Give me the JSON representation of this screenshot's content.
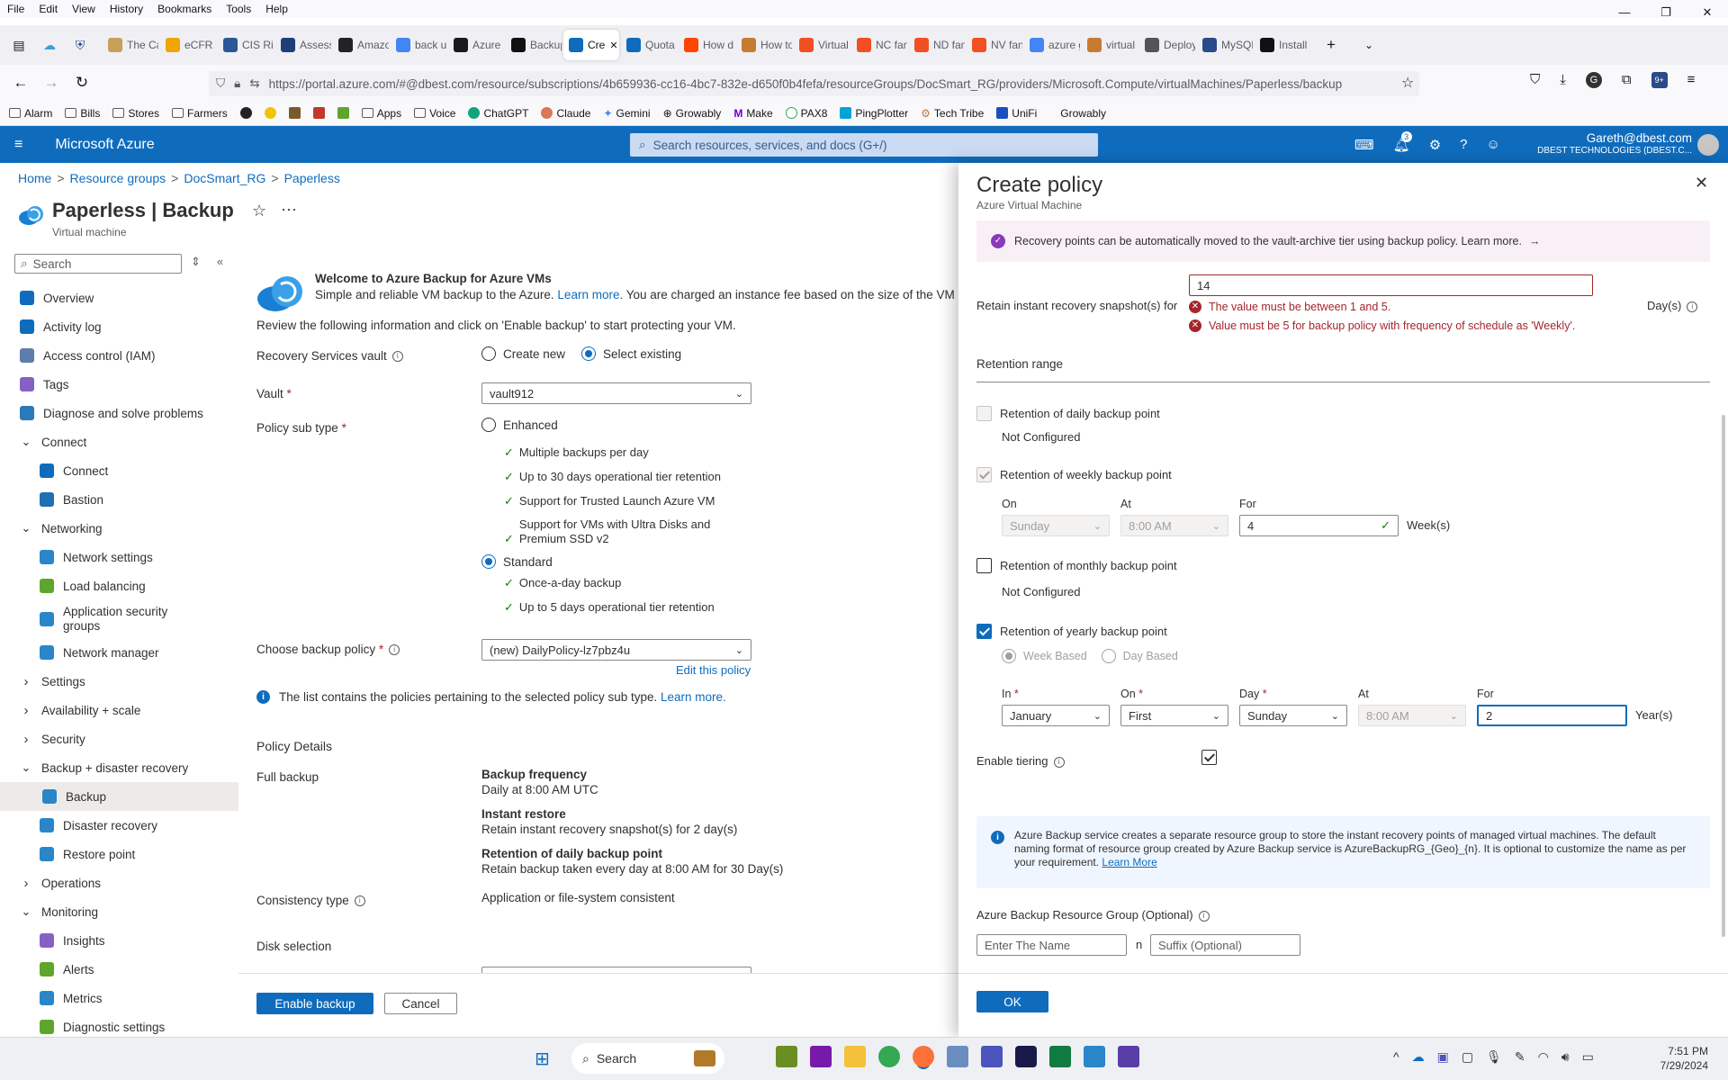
{
  "browser": {
    "menu": [
      "File",
      "Edit",
      "View",
      "History",
      "Bookmarks",
      "Tools",
      "Help"
    ],
    "tabs": [
      {
        "label": "The Ca",
        "color": "#c7a15b"
      },
      {
        "label": "eCFR ::",
        "color": "#f0a500"
      },
      {
        "label": "CIS Risl",
        "color": "#2b5797"
      },
      {
        "label": "Assess:",
        "color": "#1f3f7a"
      },
      {
        "label": "Amazo",
        "color": "#222222"
      },
      {
        "label": "back u",
        "color": "#4285f4"
      },
      {
        "label": "Azure I",
        "color": "#1a1a1a"
      },
      {
        "label": "Backup",
        "color": "#111111"
      },
      {
        "label": "Cre",
        "color": "#0f6cbd",
        "active": true
      },
      {
        "label": "Quota",
        "color": "#0f6cbd"
      },
      {
        "label": "How d",
        "color": "#ff4500"
      },
      {
        "label": "How to",
        "color": "#c77b30"
      },
      {
        "label": "Virtual",
        "color": "#f25022"
      },
      {
        "label": "NC fan",
        "color": "#f25022"
      },
      {
        "label": "ND fan",
        "color": "#f25022"
      },
      {
        "label": "NV fan",
        "color": "#f25022"
      },
      {
        "label": "azure g",
        "color": "#4285f4"
      },
      {
        "label": "virtual",
        "color": "#c77b30"
      },
      {
        "label": "Deploy",
        "color": "#555555"
      },
      {
        "label": "MySQL",
        "color": "#2b4a8a"
      },
      {
        "label": "Install I",
        "color": "#111111"
      }
    ],
    "url": "https://portal.azure.com/#@dbest.com/resource/subscriptions/4b659936-cc16-4bc7-832e-d650f0b4fefa/resourceGroups/DocSmart_RG/providers/Microsoft.Compute/virtualMachines/Paperless/backup",
    "extension_badge": "9+",
    "bookmarks": [
      "Alarm",
      "Bills",
      "Stores",
      "Farmers",
      "Apps",
      "Voice",
      "ChatGPT",
      "Claude",
      "Gemini",
      "Growably",
      "Make",
      "PAX8",
      "PingPlotter",
      "Tech Tribe",
      "UniFi",
      "Growably"
    ]
  },
  "azure": {
    "brand": "Microsoft Azure",
    "search_placeholder": "Search resources, services, and docs (G+/)",
    "notification_count": "3",
    "user_name": "Gareth@dbest.com",
    "user_org": "DBEST TECHNOLOGIES (DBEST.C..."
  },
  "breadcrumb": [
    "Home",
    "Resource groups",
    "DocSmart_RG",
    "Paperless"
  ],
  "page": {
    "title": "Paperless | Backup",
    "subtitle": "Virtual machine"
  },
  "leftnav": {
    "search_placeholder": "Search",
    "items": [
      {
        "label": "Overview",
        "level": 0,
        "icon": "#0f6cbd"
      },
      {
        "label": "Activity log",
        "level": 0,
        "icon": "#0f6cbd"
      },
      {
        "label": "Access control (IAM)",
        "level": 0,
        "icon": "#5c7ea8"
      },
      {
        "label": "Tags",
        "level": 0,
        "icon": "#8661c5"
      },
      {
        "label": "Diagnose and solve problems",
        "level": 0,
        "icon": "#2a7ab9"
      },
      {
        "label": "Connect",
        "level": 0,
        "group": true,
        "expanded": true
      },
      {
        "label": "Connect",
        "level": 1,
        "icon": "#0f6cbd"
      },
      {
        "label": "Bastion",
        "level": 1,
        "icon": "#1f6fb3"
      },
      {
        "label": "Networking",
        "level": 0,
        "group": true,
        "expanded": true
      },
      {
        "label": "Network settings",
        "level": 1,
        "icon": "#2a86c8"
      },
      {
        "label": "Load balancing",
        "level": 1,
        "icon": "#5ea52e"
      },
      {
        "label": "Application security groups",
        "level": 1,
        "icon": "#2a86c8",
        "two": true
      },
      {
        "label": "Network manager",
        "level": 1,
        "icon": "#2a86c8"
      },
      {
        "label": "Settings",
        "level": 0,
        "group": true,
        "expanded": false
      },
      {
        "label": "Availability + scale",
        "level": 0,
        "group": true,
        "expanded": false
      },
      {
        "label": "Security",
        "level": 0,
        "group": true,
        "expanded": false
      },
      {
        "label": "Backup + disaster recovery",
        "level": 0,
        "group": true,
        "expanded": true
      },
      {
        "label": "Backup",
        "level": 1,
        "icon": "#2a86c8",
        "selected": true
      },
      {
        "label": "Disaster recovery",
        "level": 1,
        "icon": "#2a86c8"
      },
      {
        "label": "Restore point",
        "level": 1,
        "icon": "#2a86c8"
      },
      {
        "label": "Operations",
        "level": 0,
        "group": true,
        "expanded": false
      },
      {
        "label": "Monitoring",
        "level": 0,
        "group": true,
        "expanded": true
      },
      {
        "label": "Insights",
        "level": 1,
        "icon": "#8661c5"
      },
      {
        "label": "Alerts",
        "level": 1,
        "icon": "#5ea52e"
      },
      {
        "label": "Metrics",
        "level": 1,
        "icon": "#2a86c8"
      },
      {
        "label": "Diagnostic settings",
        "level": 1,
        "icon": "#5ea52e"
      }
    ]
  },
  "main": {
    "welcome_title": "Welcome to Azure Backup for Azure VMs",
    "welcome_text": "Simple and reliable VM backup to the Azure.",
    "welcome_link": "Learn more.",
    "welcome_text2": "You are charged an instance fee based on the size of the VM and",
    "review_text": "Review the following information and click on 'Enable backup' to start protecting your VM.",
    "vault_label": "Recovery Services vault",
    "vault_create": "Create new",
    "vault_select": "Select existing",
    "vault_field_label": "Vault",
    "vault_value": "vault912",
    "subtype_label": "Policy sub type",
    "enhanced": "Enhanced",
    "enhanced_features": [
      "Multiple backups per day",
      "Up to 30 days operational tier retention",
      "Support for Trusted Launch Azure VM",
      "Support for VMs with Ultra Disks and Premium SSD v2"
    ],
    "standard": "Standard",
    "standard_features": [
      "Once-a-day backup",
      "Up to 5 days operational tier retention"
    ],
    "choose_policy_label": "Choose backup policy",
    "policy_value": "(new) DailyPolicy-lz7pbz4u",
    "edit_policy": "Edit this policy",
    "policy_info": "The list contains the policies pertaining to the selected policy sub type.",
    "policy_info_link": "Learn more.",
    "policy_details": "Policy Details",
    "full_backup": "Full backup",
    "backup_freq_title": "Backup frequency",
    "backup_freq": "Daily at 8:00 AM UTC",
    "instant_title": "Instant restore",
    "instant": "Retain instant recovery snapshot(s) for 2 day(s)",
    "daily_title": "Retention of daily backup point",
    "daily": "Retain backup taken every day at 8:00 AM for 30 Day(s)",
    "consistency_label": "Consistency type",
    "consistency": "Application or file-system consistent",
    "disk_selection": "Disk selection",
    "enable_backup": "Enable backup",
    "cancel": "Cancel"
  },
  "blade": {
    "title": "Create policy",
    "subtitle": "Azure Virtual Machine",
    "banner": "Recovery points can be automatically moved to the vault-archive tier using backup policy. Learn more.",
    "instant_label": "Retain instant recovery snapshot(s) for",
    "instant_value": "14",
    "instant_unit": "Day(s)",
    "err1": "The value must be between 1 and 5.",
    "err2": "Value must be 5 for backup policy with frequency of schedule as 'Weekly'.",
    "retention_range": "Retention range",
    "daily_label": "Retention of daily backup point",
    "daily_status": "Not Configured",
    "weekly_label": "Retention of weekly backup point",
    "weekly_on_lbl": "On",
    "weekly_on": "Sunday",
    "weekly_at_lbl": "At",
    "weekly_at": "8:00 AM",
    "weekly_for_lbl": "For",
    "weekly_for": "4",
    "weekly_unit": "Week(s)",
    "monthly_label": "Retention of monthly backup point",
    "monthly_status": "Not Configured",
    "yearly_label": "Retention of yearly backup point",
    "week_based": "Week Based",
    "day_based": "Day Based",
    "in_lbl": "In",
    "in_val": "January",
    "on_lbl": "On",
    "on_val": "First",
    "day_lbl": "Day",
    "day_val": "Sunday",
    "at_lbl": "At",
    "at_val": "8:00 AM",
    "for_lbl": "For",
    "for_val": "2",
    "year_unit": "Year(s)",
    "tiering_label": "Enable tiering",
    "rg_info": "Azure Backup service creates a separate resource group to store the instant recovery points of managed virtual machines. The default naming format of resource group created by Azure Backup service is AzureBackupRG_{Geo}_{n}. It is optional to customize the name as per your requirement.",
    "rg_info_link": "Learn More",
    "rg_label": "Azure Backup Resource Group (Optional)",
    "rg_name_placeholder": "Enter The Name",
    "rg_n": "n",
    "rg_suffix_placeholder": "Suffix (Optional)",
    "ok": "OK"
  },
  "taskbar": {
    "search": "Search",
    "time": "7:51 PM",
    "date": "7/29/2024"
  }
}
